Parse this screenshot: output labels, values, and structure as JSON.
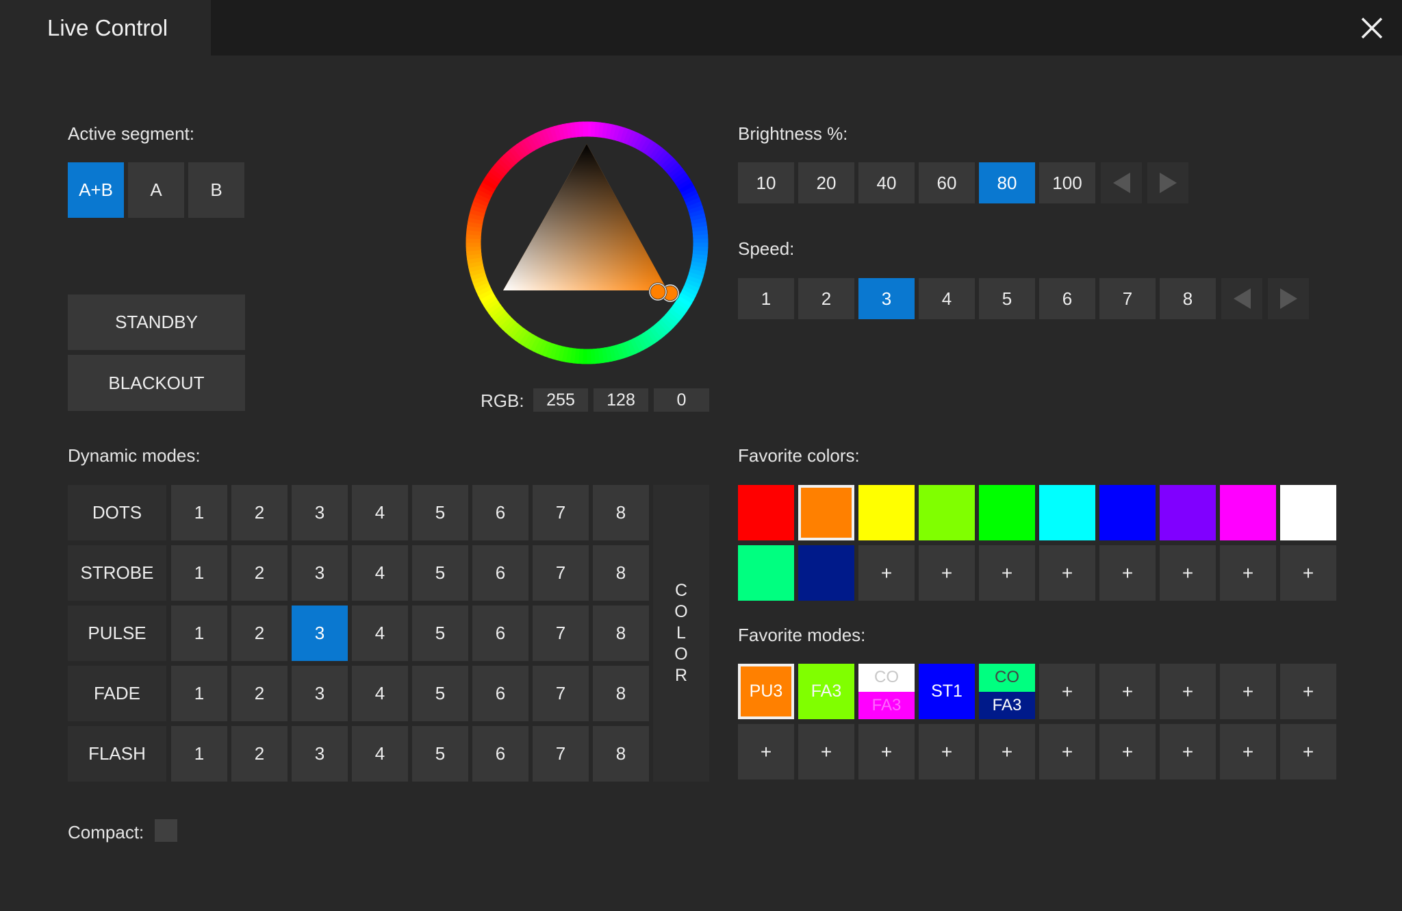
{
  "window": {
    "title": "Live Control",
    "close_icon": "close-icon"
  },
  "active_segment": {
    "label": "Active segment:",
    "options": [
      "A+B",
      "A",
      "B"
    ],
    "selected": "A+B"
  },
  "actions": {
    "standby": "STANDBY",
    "blackout": "BLACKOUT"
  },
  "color_picker": {
    "rgb_label": "RGB:",
    "r": "255",
    "g": "128",
    "b": "0",
    "current_color": "#ff8000"
  },
  "brightness": {
    "label": "Brightness %:",
    "options": [
      "10",
      "20",
      "40",
      "60",
      "80",
      "100"
    ],
    "selected": "80",
    "prev_icon": "triangle-left-icon",
    "next_icon": "triangle-right-icon"
  },
  "speed": {
    "label": "Speed:",
    "options": [
      "1",
      "2",
      "3",
      "4",
      "5",
      "6",
      "7",
      "8"
    ],
    "selected": "3",
    "prev_icon": "triangle-left-icon",
    "next_icon": "triangle-right-icon"
  },
  "dynamic_modes": {
    "label": "Dynamic modes:",
    "modes": [
      "DOTS",
      "STROBE",
      "PULSE",
      "FADE",
      "FLASH"
    ],
    "levels": [
      "1",
      "2",
      "3",
      "4",
      "5",
      "6",
      "7",
      "8"
    ],
    "selected_mode": "PULSE",
    "selected_level": "3",
    "color_button": "COLOR"
  },
  "favorite_colors": {
    "label": "Favorite colors:",
    "colors": [
      "#ff0000",
      "#ff8000",
      "#ffff00",
      "#80ff00",
      "#00ff00",
      "#00ffff",
      "#0000ff",
      "#8000ff",
      "#ff00ff",
      "#ffffff",
      "#00ff80",
      "#001a8a"
    ],
    "selected_index": 1,
    "empty_label": "+"
  },
  "favorite_modes": {
    "label": "Favorite modes:",
    "items": [
      {
        "label": "PU3",
        "color": "#ff8000",
        "selected": true
      },
      {
        "label": "FA3",
        "color": "#80ff00"
      },
      {
        "top": "CO",
        "bottom": "FA3",
        "top_color": "#ffffff",
        "bottom_color": "#ff00ff"
      },
      {
        "label": "ST1",
        "color": "#0000ff"
      },
      {
        "top": "CO",
        "bottom": "FA3",
        "top_color": "#00ff80",
        "bottom_color": "#001a8a"
      }
    ],
    "empty_label": "+"
  },
  "compact": {
    "label": "Compact:"
  }
}
